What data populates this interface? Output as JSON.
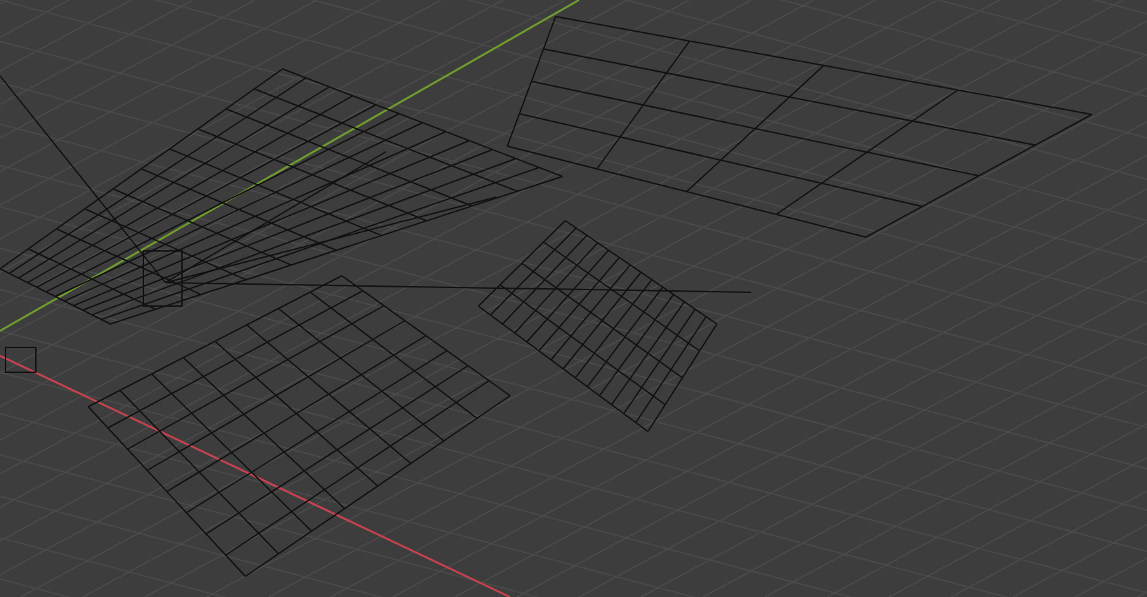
{
  "viewport": {
    "wireframe": true
  }
}
